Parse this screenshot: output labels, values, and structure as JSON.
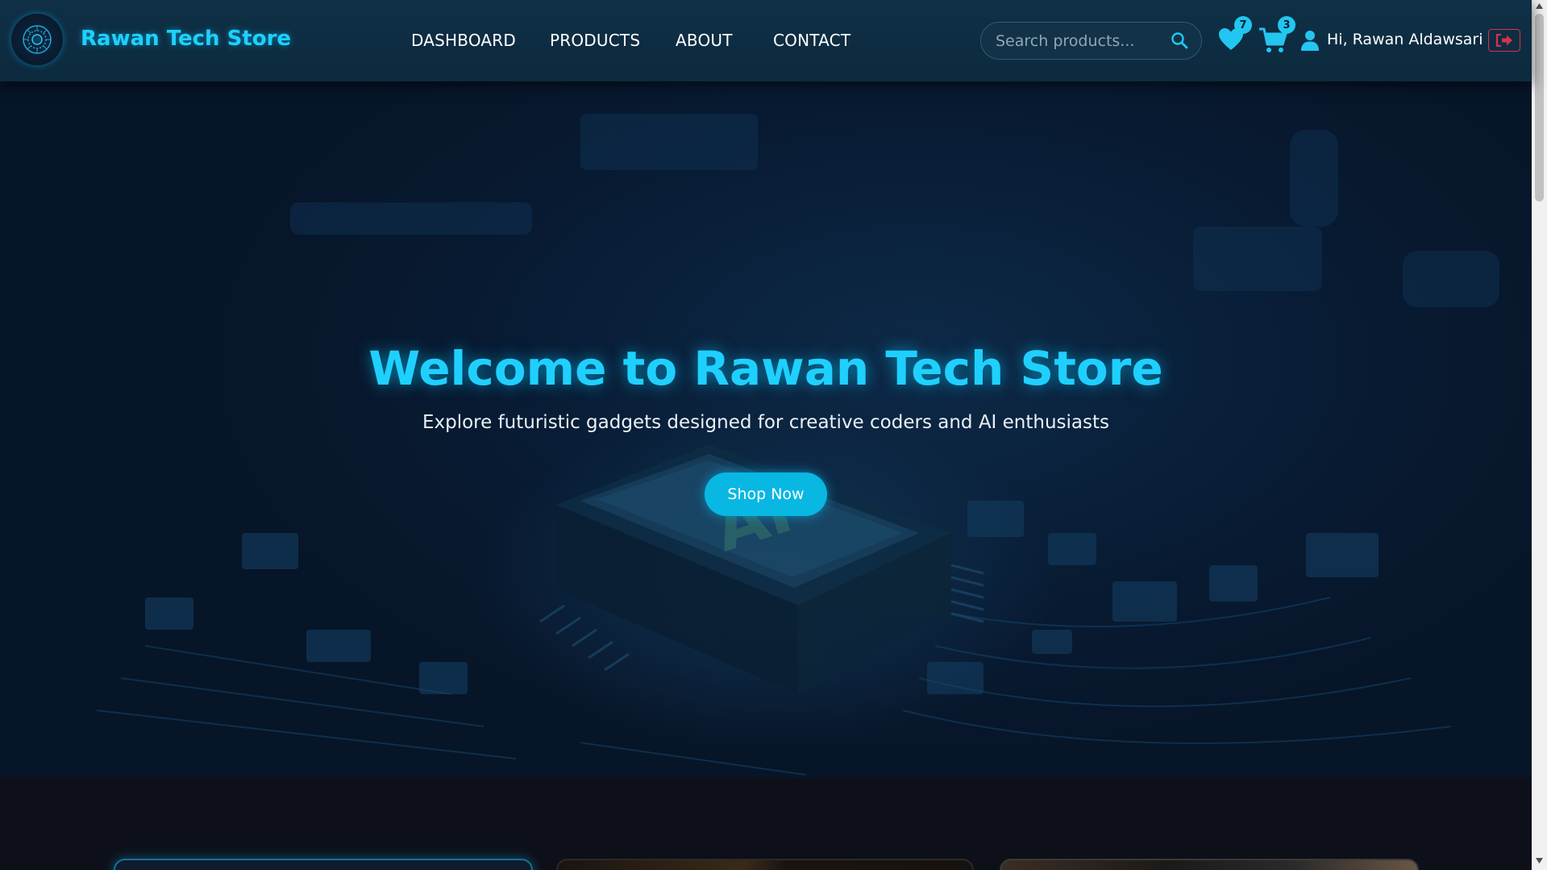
{
  "navbar": {
    "brand": "Rawan Tech Store",
    "links": [
      "DASHBOARD",
      "PRODUCTS",
      "ABOUT",
      "CONTACT"
    ],
    "search": {
      "placeholder": "Search products...",
      "value": ""
    },
    "wishlist": {
      "icon": "heart-icon",
      "count": "7"
    },
    "cart": {
      "icon": "cart-icon",
      "count": "3"
    },
    "user": {
      "icon": "user-icon",
      "greeting": "Hi, Rawan Aldawsari"
    },
    "logout": {
      "icon": "logout-icon"
    }
  },
  "hero": {
    "title": "Welcome to Rawan Tech Store",
    "subtitle": "Explore futuristic gadgets designed for creative coders and AI enthusiasts",
    "cta": "Shop Now",
    "chip_label": "AI"
  },
  "colors": {
    "accent": "#1fd0ff",
    "button": "#09b7e3",
    "navbar": "#0f3046",
    "logout": "#d6334b"
  }
}
